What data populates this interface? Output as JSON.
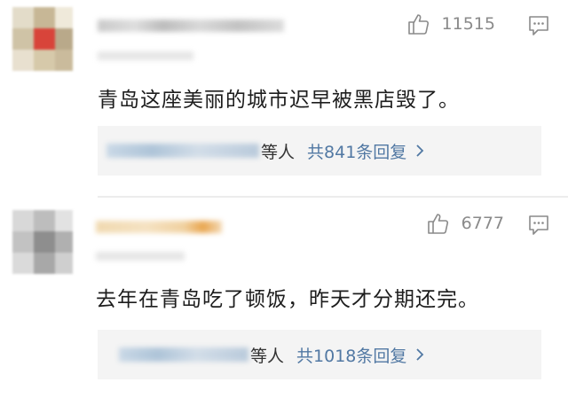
{
  "comments": [
    {
      "likes": "11515",
      "text": "青岛这座美丽的城市迟早被黑店毁了。",
      "repliers_suffix": "等人",
      "reply_count_text": "共841条回复"
    },
    {
      "likes": "6777",
      "text": "去年在青岛吃了顿饭，昨天才分期还完。",
      "repliers_suffix": "等人",
      "reply_count_text": "共1018条回复"
    }
  ],
  "icons": {
    "like": "thumb-up-icon",
    "reply": "comment-icon",
    "expand": "chevron-right-icon"
  },
  "colors": {
    "link": "#5178a3",
    "meta": "#8a8a8a",
    "text": "#1d1d1d",
    "reply_bg": "#f4f4f4"
  }
}
